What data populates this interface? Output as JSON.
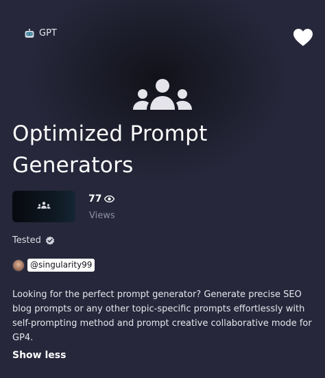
{
  "header": {
    "tag_label": "GPT",
    "tag_icon": "robot-icon",
    "favorite_icon": "heart-icon"
  },
  "hero": {
    "icon": "users-group-icon"
  },
  "title": "Optimized Prompt Generators",
  "stats": {
    "views_count": "77",
    "views_label": "Views",
    "views_icon": "eye-icon"
  },
  "badge": {
    "tested_label": "Tested",
    "tested_icon": "verified-check-icon"
  },
  "author": {
    "handle": "@singularity99"
  },
  "description": "Looking for the perfect prompt generator? Generate precise SEO blog prompts or any other topic-specific prompts effortlessly with self-prompting method and prompt creative collaborative mode for GP4.",
  "actions": {
    "show_less_label": "Show less"
  },
  "colors": {
    "background": "#26273a",
    "hero_dark": "#111219",
    "text_primary": "#ffffff",
    "text_muted": "#8e90a4"
  }
}
